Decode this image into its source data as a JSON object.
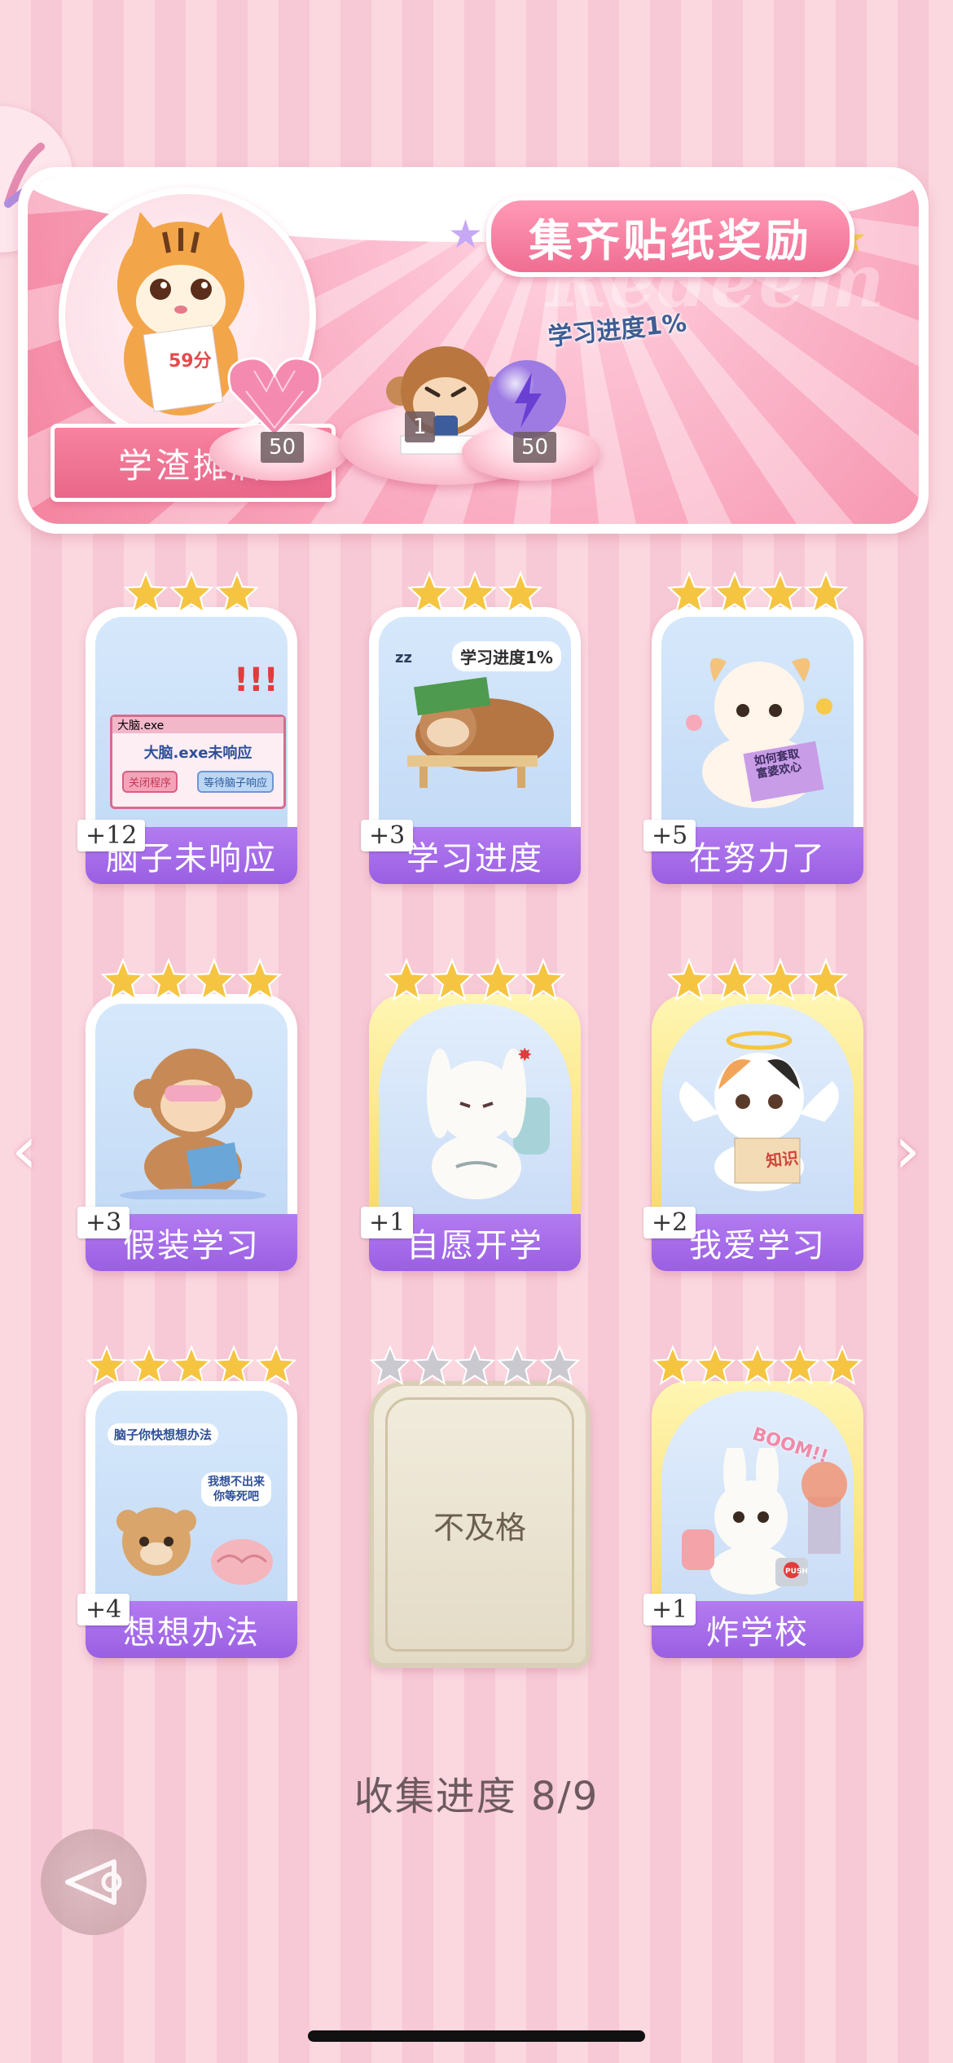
{
  "banner": {
    "title": "集齐贴纸奖励",
    "watermark": "Redeem",
    "profile_label": "学渣摊牌",
    "tiger_paper": "59分",
    "progress_caption": "学习进度1%",
    "rewards": [
      {
        "icon": "pink-heart-gem-icon",
        "count": "50"
      },
      {
        "icon": "monkey-sticker-icon",
        "count": "1"
      },
      {
        "icon": "purple-lightning-orb-icon",
        "count": "50"
      }
    ]
  },
  "cards": [
    {
      "label": "脑子未响应",
      "bonus": "+12",
      "stars": 3,
      "gold": false,
      "art_text_1": "大脑.exe",
      "art_text_2": "大脑.exe未响应",
      "art_btn_1": "关闭程序",
      "art_btn_2": "等待脑子响应"
    },
    {
      "label": "学习进度",
      "bonus": "+3",
      "stars": 3,
      "gold": false,
      "art_text_1": "学习进度1%",
      "art_text_2": "zz"
    },
    {
      "label": "在努力了",
      "bonus": "+5",
      "stars": 4,
      "gold": false,
      "art_text_1": "如何套取",
      "art_text_2": "富婆欢心"
    },
    {
      "label": "假装学习",
      "bonus": "+3",
      "stars": 4,
      "gold": false
    },
    {
      "label": "自愿开学",
      "bonus": "+1",
      "stars": 4,
      "gold": true
    },
    {
      "label": "我爱学习",
      "bonus": "+2",
      "stars": 4,
      "gold": true,
      "art_text_1": "知识"
    },
    {
      "label": "想想办法",
      "bonus": "+4",
      "stars": 5,
      "gold": false,
      "art_text_1": "脑子你快想想办法",
      "art_text_2": "我想不出来",
      "art_text_3": "你等死吧"
    },
    {
      "label": "不及格",
      "locked": true,
      "stars": 5
    },
    {
      "label": "炸学校",
      "bonus": "+1",
      "stars": 5,
      "gold": true,
      "art_text_1": "BOOM!!",
      "art_text_2": "PUSH"
    }
  ],
  "nav": {
    "prev_icon": "chevron-left-icon",
    "next_icon": "chevron-right-icon"
  },
  "collection": {
    "progress": "收集进度  8/9"
  },
  "back_button": {
    "icon": "back-arrow-icon"
  },
  "colors": {
    "pink_accent": "#f06d92",
    "purple_label": "#9a5fe3",
    "star_gold": "#f5c542",
    "star_silver": "#c9c9cf"
  }
}
